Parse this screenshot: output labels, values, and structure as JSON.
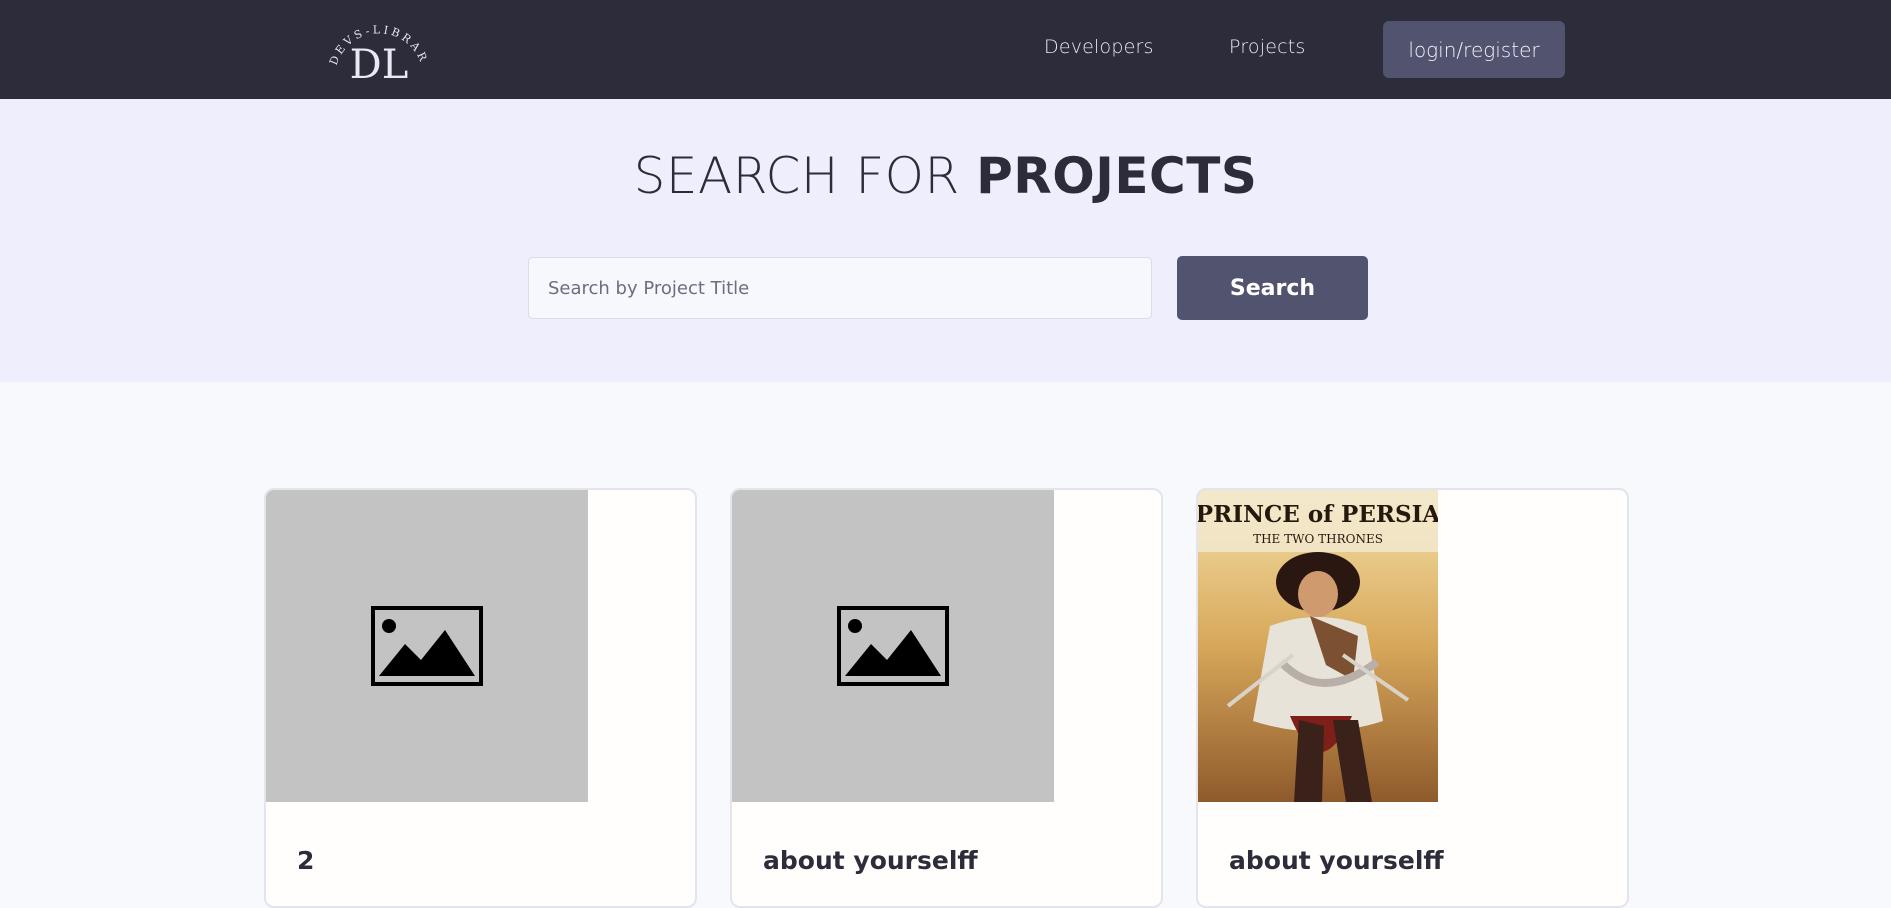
{
  "header": {
    "logo_text": "DEVS-LIBRARY",
    "logo_monogram": "DL",
    "nav": [
      "Developers",
      "Projects"
    ],
    "login_label": "login/register"
  },
  "hero": {
    "title_light": "SEARCH FOR ",
    "title_bold": "PROJECTS",
    "search_placeholder": "Search by Project Title",
    "search_button": "Search"
  },
  "projects": [
    {
      "title": "2",
      "image": "placeholder-image-icon"
    },
    {
      "title": "about yourselff",
      "image": "placeholder-image-icon"
    },
    {
      "title": "about yourselff",
      "image": "prince-of-persia-cover",
      "cover_title": "PRINCE of PERSIA",
      "cover_subtitle": "THE TWO THRONES"
    }
  ],
  "colors": {
    "header_bg": "#2c2c3a",
    "hero_bg": "#eeeefd",
    "accent_button": "#52546f",
    "page_bg": "#f8f9fd"
  }
}
